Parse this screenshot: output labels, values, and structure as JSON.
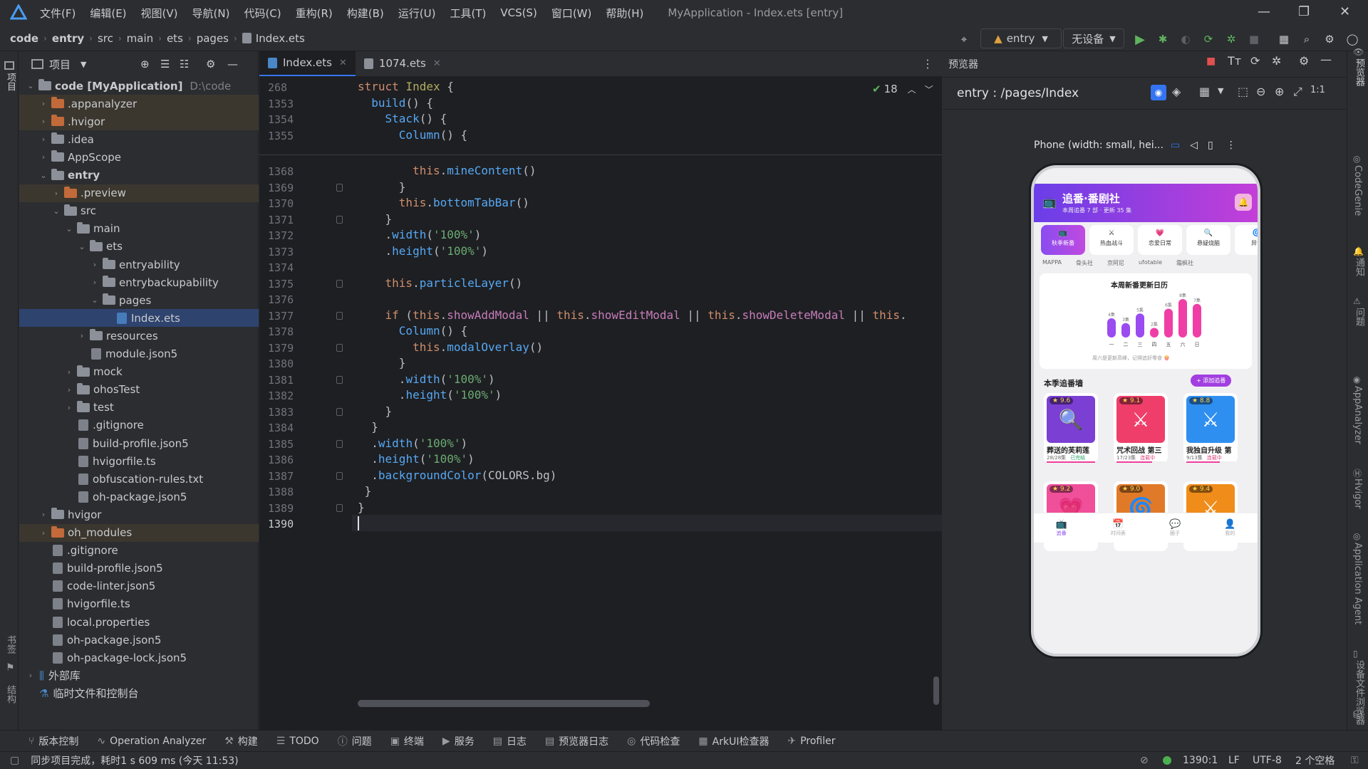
{
  "window": {
    "title": "MyApplication - Index.ets [entry]",
    "menu": [
      "文件(F)",
      "编辑(E)",
      "视图(V)",
      "导航(N)",
      "代码(C)",
      "重构(R)",
      "构建(B)",
      "运行(U)",
      "工具(T)",
      "VCS(S)",
      "窗口(W)",
      "帮助(H)"
    ]
  },
  "nav": {
    "breadcrumb": [
      "code",
      "entry",
      "src",
      "main",
      "ets",
      "pages",
      "Index.ets"
    ],
    "module": "entry",
    "device": "无设备"
  },
  "left_tools": {
    "project": "项目",
    "bookmarks": "书签",
    "structure": "结构"
  },
  "project": {
    "title": "项目",
    "items": [
      {
        "label": "code [MyApplication]",
        "extra": "D:\\code"
      },
      {
        "label": ".appanalyzer"
      },
      {
        "label": ".hvigor"
      },
      {
        "label": ".idea"
      },
      {
        "label": "AppScope"
      },
      {
        "label": "entry"
      },
      {
        "label": ".preview"
      },
      {
        "label": "src"
      },
      {
        "label": "main"
      },
      {
        "label": "ets"
      },
      {
        "label": "entryability"
      },
      {
        "label": "entrybackupability"
      },
      {
        "label": "pages"
      },
      {
        "label": "Index.ets"
      },
      {
        "label": "resources"
      },
      {
        "label": "module.json5"
      },
      {
        "label": "mock"
      },
      {
        "label": "ohosTest"
      },
      {
        "label": "test"
      },
      {
        "label": ".gitignore"
      },
      {
        "label": "build-profile.json5"
      },
      {
        "label": "hvigorfile.ts"
      },
      {
        "label": "obfuscation-rules.txt"
      },
      {
        "label": "oh-package.json5"
      },
      {
        "label": "hvigor"
      },
      {
        "label": "oh_modules"
      },
      {
        "label": ".gitignore"
      },
      {
        "label": "build-profile.json5"
      },
      {
        "label": "code-linter.json5"
      },
      {
        "label": "hvigorfile.ts"
      },
      {
        "label": "local.properties"
      },
      {
        "label": "oh-package.json5"
      },
      {
        "label": "oh-package-lock.json5"
      },
      {
        "label": "外部库"
      },
      {
        "label": "临时文件和控制台"
      }
    ]
  },
  "editor": {
    "tabs": [
      "Index.ets",
      "1074.ets"
    ],
    "problems": "18",
    "sticky_lines": [
      "268",
      "1353",
      "1354",
      "1355"
    ],
    "lines": [
      "1368",
      "1369",
      "1370",
      "1371",
      "1372",
      "1373",
      "1374",
      "1375",
      "1376",
      "1377",
      "1378",
      "1379",
      "1380",
      "1381",
      "1382",
      "1383",
      "1384",
      "1385",
      "1386",
      "1387",
      "1388",
      "1389",
      "1390"
    ]
  },
  "preview": {
    "title": "预览器",
    "path": "entry : /pages/Index",
    "device": "Phone (width: small, hei...",
    "app": {
      "title": "追番·番剧社",
      "subtitle": "本周追番 7 部 · 更新 35 集",
      "tabs": [
        "秋季新番",
        "热血战斗",
        "恋爱日常",
        "悬疑烧脑",
        "异世"
      ],
      "tags": [
        "MAPPA",
        "骨头社",
        "京阿尼",
        "ufotable",
        "霜枫社"
      ],
      "calendar_title": "本周新番更新日历",
      "calendar_hint": "周六是更新高峰，记得追好零食 🍿",
      "wall_title": "本季追番墙",
      "add_button": "+ 添加追番",
      "cards": [
        {
          "rating": "★ 9.6",
          "title": "葬送的芙莉莲",
          "sub": "28/28集",
          "badge": "已完结",
          "progress": 1.0,
          "color": "#7b3fd4",
          "icon": "🔍"
        },
        {
          "rating": "★ 9.1",
          "title": "咒术回战 第三",
          "sub": "17/23集",
          "badge": "连载中",
          "progress": 0.74,
          "color": "#ef3e6a",
          "icon": "⚔"
        },
        {
          "rating": "★ 8.8",
          "title": "我独自升级 第",
          "sub": "9/13集",
          "badge": "连载中",
          "progress": 0.69,
          "color": "#2f8ff0",
          "icon": "⚔"
        },
        {
          "rating": "★ 9.2",
          "title": "",
          "sub": "",
          "badge": "",
          "progress": 0,
          "color": "#f04f9a",
          "icon": "💗"
        },
        {
          "rating": "★ 9.0",
          "title": "",
          "sub": "",
          "badge": "",
          "progress": 0,
          "color": "#e07a28",
          "icon": "🌀"
        },
        {
          "rating": "★ 9.4",
          "title": "",
          "sub": "",
          "badge": "",
          "progress": 0,
          "color": "#f08c1a",
          "icon": "⚔"
        }
      ],
      "bottom_tabs": [
        "追番",
        "时间表",
        "圈子",
        "我的"
      ]
    }
  },
  "chart_data": {
    "type": "bar",
    "title": "本周新番更新日历",
    "categories": [
      "一",
      "二",
      "三",
      "四",
      "五",
      "六",
      "日"
    ],
    "values": [
      4,
      3,
      5,
      2,
      6,
      8,
      7
    ],
    "labels": [
      "4集",
      "3集",
      "5集",
      "2集",
      "6集",
      "8集",
      "7集"
    ],
    "ylim": [
      0,
      8
    ]
  },
  "right_tools": [
    "预览器",
    "CodeGenie",
    "通知",
    "问题",
    "AppAnalyzer",
    "Hvigor",
    "Application Agent",
    "设备文件浏览器"
  ],
  "bottom_tools": [
    "版本控制",
    "Operation Analyzer",
    "构建",
    "TODO",
    "问题",
    "终端",
    "服务",
    "日志",
    "预览器日志",
    "代码检查",
    "ArkUI检查器",
    "Profiler"
  ],
  "status": {
    "message": "同步项目完成，耗时1 s 609 ms (今天 11:53)",
    "position": "1390:1",
    "line_sep": "LF",
    "encoding": "UTF-8",
    "indent": "2 个空格"
  }
}
